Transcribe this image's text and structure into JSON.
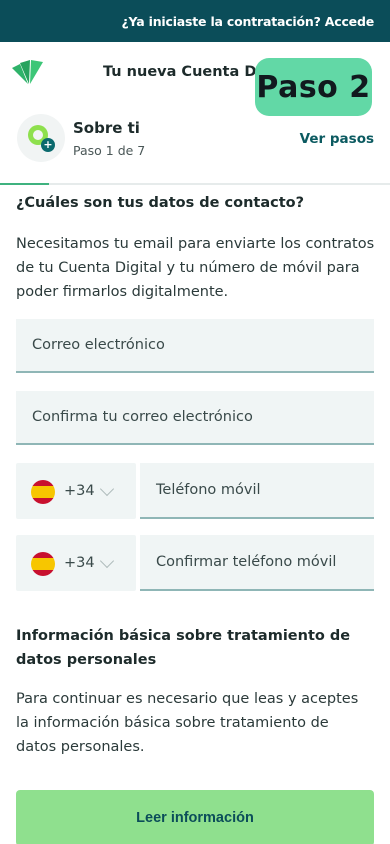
{
  "topbar": {
    "link_label": "¿Ya iniciaste la contratación? Accede"
  },
  "header": {
    "title": "Tu nueva Cuenta Digi",
    "step_badge": "Paso 2"
  },
  "step": {
    "title": "Sobre ti",
    "subtitle": "Paso 1 de 7",
    "ver_pasos": "Ver pasos",
    "progress_fraction": 0.125
  },
  "form": {
    "question": "¿Cuáles son tus datos de contacto?",
    "intro": "Necesitamos tu email para enviarte los contratos de tu Cuenta Digital y tu número de móvil para poder firmarlos digitalmente.",
    "email_placeholder": "Correo electrónico",
    "email_confirm_placeholder": "Confirma tu correo electrónico",
    "country_code": "+34",
    "phone_placeholder": "Teléfono móvil",
    "phone_confirm_placeholder": "Confirmar teléfono móvil"
  },
  "info": {
    "title": "Información básica sobre tratamiento de datos personales",
    "body": "Para continuar es necesario que leas y aceptes la información básica sobre tratamiento de datos personales.",
    "button_label": "Leer información"
  },
  "colors": {
    "topbar": "#0b4d59",
    "badge": "#62d8a6",
    "button": "#8fe08e",
    "accent": "#3fb27f"
  }
}
